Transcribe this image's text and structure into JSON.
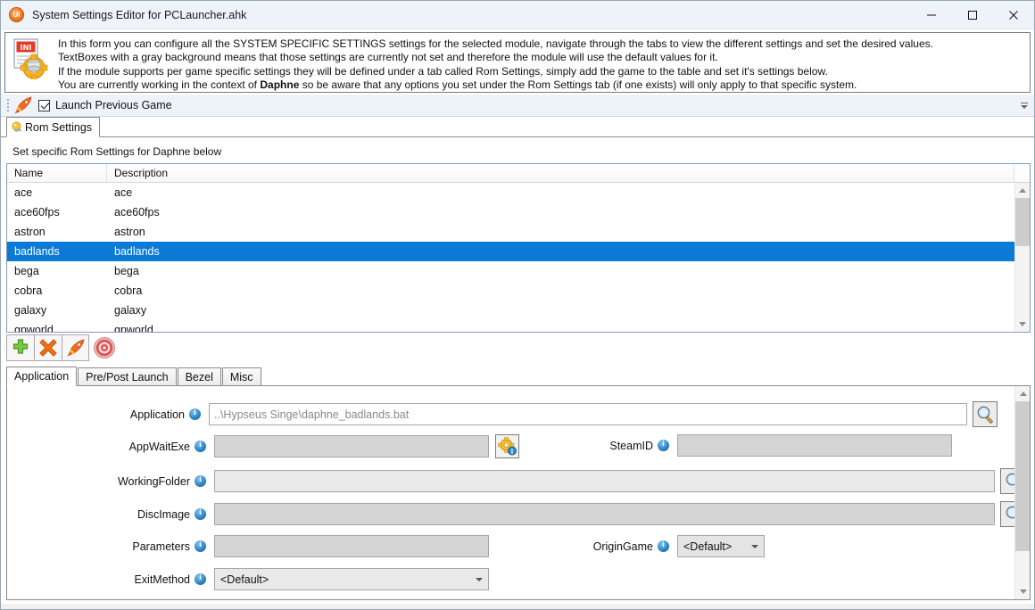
{
  "window": {
    "title": "System Settings Editor for PCLauncher.ahk",
    "app_icon": "ui-circle-icon",
    "controls": {
      "minimize": "minimize-icon",
      "maximize": "maximize-icon",
      "close": "close-icon"
    }
  },
  "info_banner": {
    "icon": "ini-file-gear-icon",
    "lines": [
      "In this form you can configure all the SYSTEM SPECIFIC SETTINGS settings for the selected module, navigate through the tabs to view the different settings and set the desired values.",
      "TextBoxes with a gray background means that those settings are currently not set and therefore the module will use the default values for it.",
      "If the module supports per game specific settings they will be defined under a tab called Rom Settings, simply add the game to the table and set it's settings below."
    ],
    "line4_prefix": "You are currently working in the context of ",
    "line4_bold": "Daphne",
    "line4_suffix": " so be aware that any options you set under the Rom Settings tab (if one exists) will only apply to that specific system."
  },
  "toolbar": {
    "grip": "drag-grip",
    "rocket_icon": "rocket-icon",
    "checkbox_label": "Launch Previous Game",
    "checkbox_checked": true,
    "overflow": "toolbar-overflow-icon"
  },
  "top_tabs": [
    {
      "label": "Rom Settings",
      "icon": "bulb-icon",
      "active": true
    }
  ],
  "sub_label": "Set specific Rom Settings for Daphne below",
  "grid": {
    "columns": [
      "Name",
      "Description"
    ],
    "rows": [
      {
        "name": "ace",
        "description": "ace",
        "selected": false
      },
      {
        "name": "ace60fps",
        "description": "ace60fps",
        "selected": false
      },
      {
        "name": "astron",
        "description": "astron",
        "selected": false
      },
      {
        "name": "badlands",
        "description": "badlands",
        "selected": true
      },
      {
        "name": "bega",
        "description": "bega",
        "selected": false
      },
      {
        "name": "cobra",
        "description": "cobra",
        "selected": false
      },
      {
        "name": "galaxy",
        "description": "galaxy",
        "selected": false
      },
      {
        "name": "gpworld",
        "description": "gpworld",
        "selected": false
      }
    ]
  },
  "action_buttons": [
    {
      "name": "add-rom-button",
      "icon": "green-plus-icon"
    },
    {
      "name": "delete-rom-button",
      "icon": "orange-x-icon"
    },
    {
      "name": "launch-rom-button",
      "icon": "rocket-icon"
    },
    {
      "name": "target-button",
      "icon": "bullseye-target-icon"
    }
  ],
  "bottom_tabs": [
    {
      "label": "Application",
      "active": true
    },
    {
      "label": "Pre/Post Launch",
      "active": false
    },
    {
      "label": "Bezel",
      "active": false
    },
    {
      "label": "Misc",
      "active": false
    }
  ],
  "form": {
    "application": {
      "label": "Application",
      "value": "..\\Hypseus Singe\\daphne_badlands.bat",
      "browse_icon": "magnifier-icon"
    },
    "appwaitexe": {
      "label": "AppWaitExe",
      "value": "",
      "gear_icon": "gear-info-icon"
    },
    "steamid": {
      "label": "SteamID",
      "value": ""
    },
    "workingfolder": {
      "label": "WorkingFolder",
      "value": "",
      "browse_icon": "magnifier-icon"
    },
    "discimage": {
      "label": "DiscImage",
      "value": "",
      "browse_icon": "magnifier-icon"
    },
    "parameters": {
      "label": "Parameters",
      "value": ""
    },
    "origingame": {
      "label": "OriginGame",
      "value": "<Default>"
    },
    "exitmethod": {
      "label": "ExitMethod",
      "value": "<Default>"
    }
  },
  "colors": {
    "selection": "#0b7ad6",
    "titlebar": "#eef3f9",
    "disabled_field": "#d4d4d4"
  }
}
